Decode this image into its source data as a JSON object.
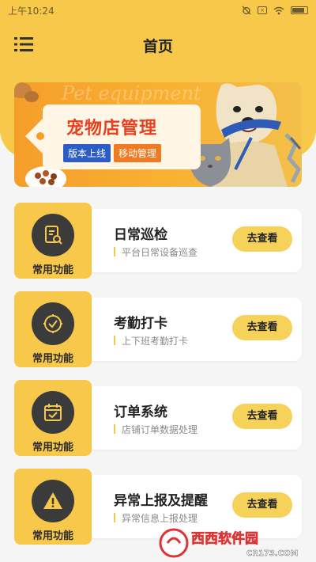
{
  "status_bar": {
    "time": "上午10:24",
    "icons": [
      "alarm-off-icon",
      "sim-x-icon",
      "wifi-icon",
      "battery-icon"
    ]
  },
  "header": {
    "title": "首页",
    "menu_icon": "menu-icon"
  },
  "banner": {
    "title": "宠物店管理",
    "badge_1": "版本上线",
    "badge_2": "移动管理",
    "background_text": "Pet equipment"
  },
  "cards": [
    {
      "left_label": "常用功能",
      "icon": "document-search-icon",
      "title": "日常巡检",
      "subtitle": "平台日常设备巡查",
      "button": "去查看"
    },
    {
      "left_label": "常用功能",
      "icon": "clock-check-icon",
      "title": "考勤打卡",
      "subtitle": "上下班考勤打卡",
      "button": "去查看"
    },
    {
      "left_label": "常用功能",
      "icon": "calendar-check-icon",
      "title": "订单系统",
      "subtitle": "店铺订单数据处理",
      "button": "去查看"
    },
    {
      "left_label": "常用功能",
      "icon": "warning-icon",
      "title": "异常上报及提醒",
      "subtitle": "异常信息上报处理",
      "button": "去查看"
    }
  ],
  "watermark": {
    "brand": "西西软件园",
    "url": "CR173.COM"
  },
  "colors": {
    "accent_yellow": "#f7c84a",
    "button_yellow": "#f7d25a",
    "banner_red": "#e8401f",
    "badge_blue": "#2b5cc7",
    "badge_orange": "#f07a22"
  }
}
